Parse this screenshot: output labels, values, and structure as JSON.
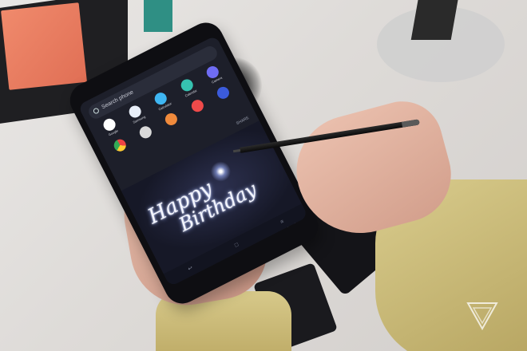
{
  "phone": {
    "search_placeholder": "Search phone",
    "apps": [
      {
        "label": "Google",
        "color": "#ffffff"
      },
      {
        "label": "Samsung",
        "color": "#e8eef8"
      },
      {
        "label": "Calculator",
        "color": "#3fb6f2"
      },
      {
        "label": "Calendar",
        "color": "#36c2b0"
      },
      {
        "label": "Camera",
        "color": "#6f6cf3"
      },
      {
        "label": "",
        "color": "#f0f0f0"
      },
      {
        "label": "",
        "color": "#d9d9d9"
      },
      {
        "label": "",
        "color": "#f08a3c"
      },
      {
        "label": "",
        "color": "#ef4a4a"
      },
      {
        "label": "",
        "color": "#3b5bdb"
      }
    ],
    "share_label": "SHARE",
    "handwriting_line1": "Happy",
    "handwriting_line2": "Birthday"
  },
  "colors": {
    "sleeve": "#cfc07e",
    "cube": "#e9785d"
  }
}
